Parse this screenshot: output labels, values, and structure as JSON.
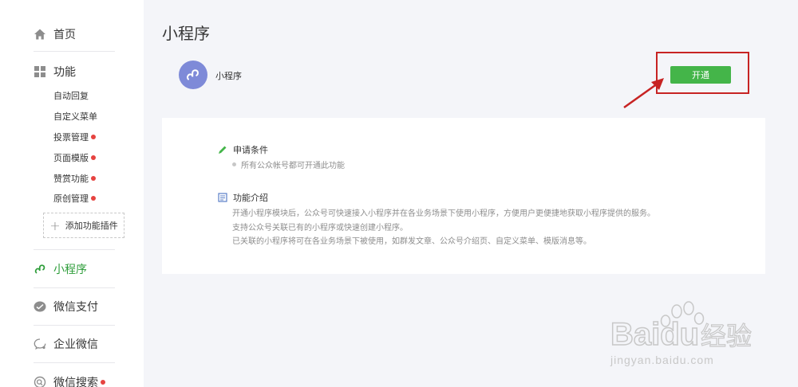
{
  "sidebar": {
    "home": "首页",
    "features": "功能",
    "sub_items": [
      {
        "label": "自动回复",
        "dot": false
      },
      {
        "label": "自定义菜单",
        "dot": false
      },
      {
        "label": "投票管理",
        "dot": true
      },
      {
        "label": "页面模版",
        "dot": true
      },
      {
        "label": "赞赏功能",
        "dot": true
      },
      {
        "label": "原创管理",
        "dot": true
      }
    ],
    "add_plugin": "添加功能插件",
    "mini_program": "小程序",
    "wechat_pay": "微信支付",
    "enterprise_wechat": "企业微信",
    "wechat_search": "微信搜索"
  },
  "main": {
    "title": "小程序",
    "mp_name": "小程序",
    "open_button": "开通",
    "requirements": {
      "heading": "申请条件",
      "item": "所有公众帐号都可开通此功能"
    },
    "intro": {
      "heading": "功能介绍",
      "lines": [
        "开通小程序模块后，公众号可快速接入小程序并在各业务场景下使用小程序，方便用户更便捷地获取小程序提供的服务。",
        "支持公众号关联已有的小程序或快速创建小程序。",
        "已关联的小程序将可在各业务场景下被使用，如群发文章、公众号介绍页、自定义菜单、模版消息等。"
      ]
    }
  },
  "watermark": {
    "brand": "Baidu",
    "cn": "经验",
    "url": "jingyan.baidu.com"
  },
  "colors": {
    "accent_green": "#44b549",
    "active_green": "#2e9d3a",
    "highlight_red": "#c72323",
    "logo_purple": "#7e8ad8",
    "red_dot": "#e64340"
  },
  "icons": [
    "home-icon",
    "grid-icon",
    "link-icon",
    "wechat-pay-icon",
    "enterprise-wechat-icon",
    "search-icon",
    "pencil-icon",
    "document-icon"
  ]
}
